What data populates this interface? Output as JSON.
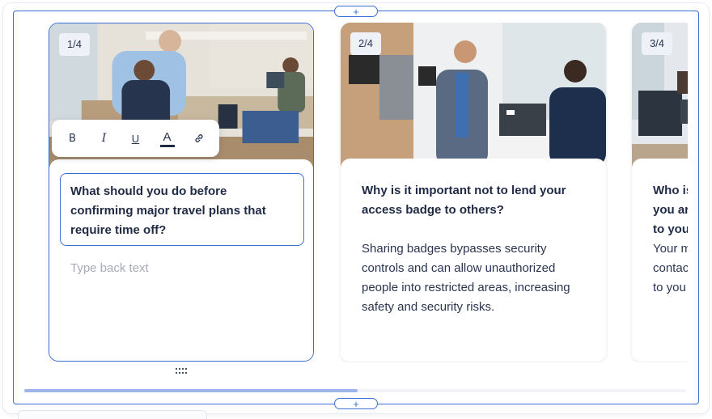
{
  "add_top_icon": "+",
  "add_bottom_icon": "+",
  "toolbar": {
    "bold": "B",
    "italic": "I",
    "underline": "U",
    "text_color": "A",
    "link_icon": "link-icon"
  },
  "cards": [
    {
      "counter": "1/4",
      "front": "What should you do before confirming major travel plans that require time off?",
      "back_placeholder": "Type back text"
    },
    {
      "counter": "2/4",
      "front": "Why is it important not to lend your access badge to others?",
      "back": "Sharing badges bypasses security controls and can allow unauthorized people into restricted areas, increasing safety and security risks."
    },
    {
      "counter": "3/4",
      "front": "Who is you ar to you",
      "back": "Your m contac to you"
    }
  ],
  "colors": {
    "accent": "#3b6fd4",
    "scroll_thumb": "#9cb6ec",
    "badge_bg": "#eef1f8"
  },
  "scroll": {
    "position_fraction": 0.5
  }
}
